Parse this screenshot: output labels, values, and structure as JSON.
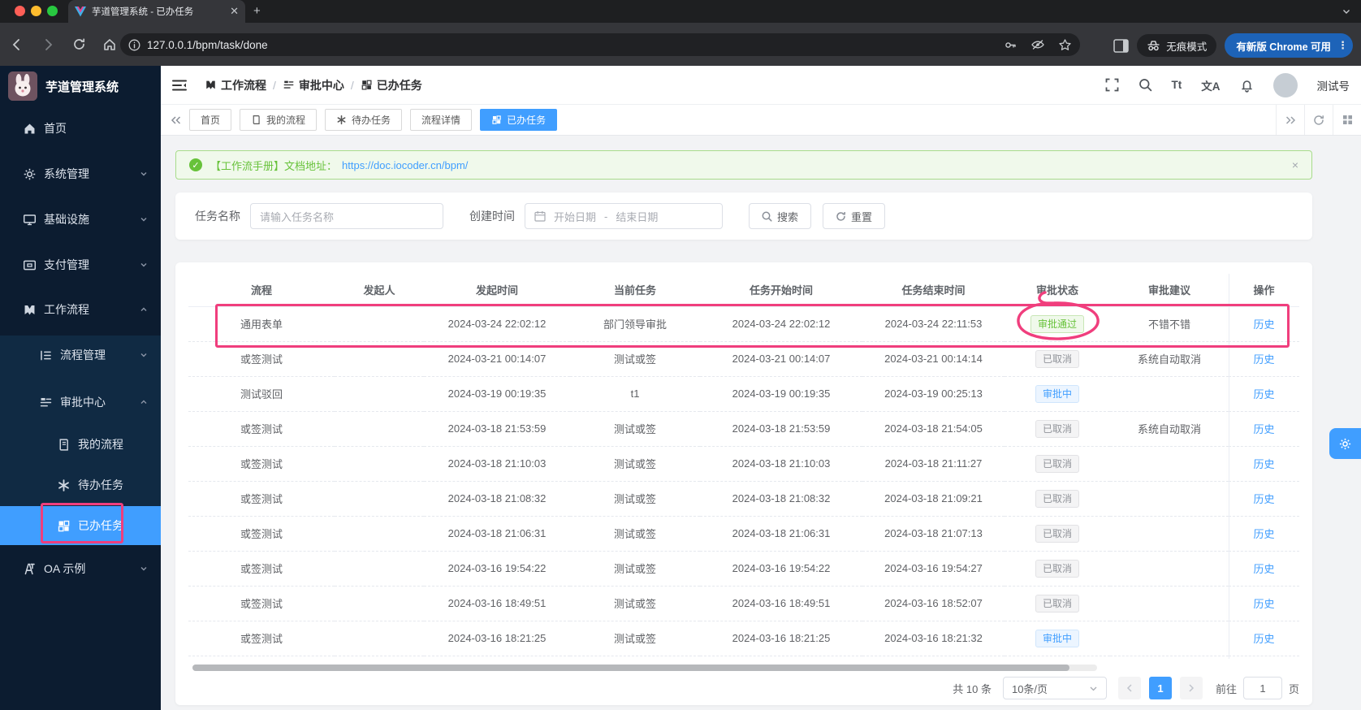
{
  "colors": {
    "primary": "#409eff",
    "success": "#67c23a",
    "info": "#909399",
    "annotation": "#f03e7d",
    "sidebar_bg": "#0c1c30",
    "sidebar_submenu_bg": "#102a43",
    "banner_bg": "#f0f9eb",
    "chrome_update_bg": "#1d63b8",
    "page_bg": "#f2f3f5"
  },
  "browser": {
    "tab_title": "芋道管理系统 - 已办任务",
    "close_glyph": "✕",
    "new_tab_glyph": "+",
    "url": "127.0.0.1/bpm/task/done",
    "incognito_label": "无痕模式",
    "update_label": "有新版 Chrome 可用",
    "kebab_glyph": "⋮"
  },
  "sidebar": {
    "brand": "芋道管理系统",
    "items": [
      {
        "label": "首页",
        "icon": "home-icon"
      },
      {
        "label": "系统管理",
        "icon": "gear-icon",
        "arrow": "down"
      },
      {
        "label": "基础设施",
        "icon": "monitor-icon",
        "arrow": "down"
      },
      {
        "label": "支付管理",
        "icon": "payment-icon",
        "arrow": "down"
      },
      {
        "label": "工作流程",
        "icon": "workflow-icon",
        "arrow": "up"
      },
      {
        "label": "流程管理",
        "icon": "process-manage-icon",
        "arrow": "down"
      },
      {
        "label": "审批中心",
        "icon": "approval-center-icon",
        "arrow": "up"
      },
      {
        "label": "我的流程",
        "icon": "my-process-icon"
      },
      {
        "label": "待办任务",
        "icon": "todo-icon"
      },
      {
        "label": "已办任务",
        "icon": "done-icon",
        "active": true
      },
      {
        "label": "OA 示例",
        "icon": "oa-icon",
        "arrow": "down"
      }
    ]
  },
  "breadcrumb": {
    "items": [
      {
        "label": "工作流程",
        "icon": "workflow-icon"
      },
      {
        "label": "审批中心",
        "icon": "approval-center-icon"
      },
      {
        "label": "已办任务",
        "icon": "done-icon"
      }
    ],
    "separator": "/"
  },
  "header": {
    "username": "测试号",
    "font_icon_text": "Tt",
    "translate_icon_text": "文A",
    "icons": [
      "fullscreen-icon",
      "search-icon",
      "font-size-icon",
      "translate-icon",
      "bell-icon"
    ]
  },
  "tabs": {
    "items": [
      {
        "label": "首页"
      },
      {
        "label": "我的流程",
        "icon": "book-icon"
      },
      {
        "label": "待办任务",
        "icon": "todo-icon"
      },
      {
        "label": "流程详情"
      },
      {
        "label": "已办任务",
        "icon": "done-icon",
        "active": true
      }
    ]
  },
  "banner": {
    "check_glyph": "✓",
    "text": "【工作流手册】文档地址：",
    "link": "https://doc.iocoder.cn/bpm/",
    "close_glyph": "×"
  },
  "search": {
    "task_label": "任务名称",
    "task_placeholder": "请输入任务名称",
    "time_label": "创建时间",
    "start_placeholder": "开始日期",
    "range_separator": "-",
    "end_placeholder": "结束日期",
    "search_button": "搜索",
    "reset_button": "重置"
  },
  "table": {
    "columns": [
      "流程",
      "发起人",
      "发起时间",
      "当前任务",
      "任务开始时间",
      "任务结束时间",
      "审批状态",
      "审批建议",
      "操作"
    ],
    "rows": [
      {
        "process": "通用表单",
        "starter": "",
        "start_time": "2024-03-24 22:02:12",
        "current_task": "部门领导审批",
        "task_start": "2024-03-24 22:02:12",
        "task_end": "2024-03-24 22:11:53",
        "status": "审批通过",
        "status_type": "success",
        "suggestion": "不错不错",
        "action": "历史"
      },
      {
        "process": "或签测试",
        "starter": "",
        "start_time": "2024-03-21 00:14:07",
        "current_task": "测试或签",
        "task_start": "2024-03-21 00:14:07",
        "task_end": "2024-03-21 00:14:14",
        "status": "已取消",
        "status_type": "info",
        "suggestion": "系统自动取消",
        "action": "历史"
      },
      {
        "process": "测试驳回",
        "starter": "",
        "start_time": "2024-03-19 00:19:35",
        "current_task": "t1",
        "task_start": "2024-03-19 00:19:35",
        "task_end": "2024-03-19 00:25:13",
        "status": "审批中",
        "status_type": "primary",
        "suggestion": "",
        "action": "历史"
      },
      {
        "process": "或签测试",
        "starter": "",
        "start_time": "2024-03-18 21:53:59",
        "current_task": "测试或签",
        "task_start": "2024-03-18 21:53:59",
        "task_end": "2024-03-18 21:54:05",
        "status": "已取消",
        "status_type": "info",
        "suggestion": "系统自动取消",
        "action": "历史"
      },
      {
        "process": "或签测试",
        "starter": "",
        "start_time": "2024-03-18 21:10:03",
        "current_task": "测试或签",
        "task_start": "2024-03-18 21:10:03",
        "task_end": "2024-03-18 21:11:27",
        "status": "已取消",
        "status_type": "info",
        "suggestion": "",
        "action": "历史"
      },
      {
        "process": "或签测试",
        "starter": "",
        "start_time": "2024-03-18 21:08:32",
        "current_task": "测试或签",
        "task_start": "2024-03-18 21:08:32",
        "task_end": "2024-03-18 21:09:21",
        "status": "已取消",
        "status_type": "info",
        "suggestion": "",
        "action": "历史"
      },
      {
        "process": "或签测试",
        "starter": "",
        "start_time": "2024-03-18 21:06:31",
        "current_task": "测试或签",
        "task_start": "2024-03-18 21:06:31",
        "task_end": "2024-03-18 21:07:13",
        "status": "已取消",
        "status_type": "info",
        "suggestion": "",
        "action": "历史"
      },
      {
        "process": "或签测试",
        "starter": "",
        "start_time": "2024-03-16 19:54:22",
        "current_task": "测试或签",
        "task_start": "2024-03-16 19:54:22",
        "task_end": "2024-03-16 19:54:27",
        "status": "已取消",
        "status_type": "info",
        "suggestion": "",
        "action": "历史"
      },
      {
        "process": "或签测试",
        "starter": "",
        "start_time": "2024-03-16 18:49:51",
        "current_task": "测试或签",
        "task_start": "2024-03-16 18:49:51",
        "task_end": "2024-03-16 18:52:07",
        "status": "已取消",
        "status_type": "info",
        "suggestion": "",
        "action": "历史"
      },
      {
        "process": "或签测试",
        "starter": "",
        "start_time": "2024-03-16 18:21:25",
        "current_task": "测试或签",
        "task_start": "2024-03-16 18:21:25",
        "task_end": "2024-03-16 18:21:32",
        "status": "审批中",
        "status_type": "primary",
        "suggestion": "",
        "action": "历史"
      }
    ]
  },
  "pagination": {
    "total": "共 10 条",
    "page_size": "10条/页",
    "current_page": "1",
    "goto_label": "前往",
    "goto_value": "1",
    "page_label": "页"
  }
}
